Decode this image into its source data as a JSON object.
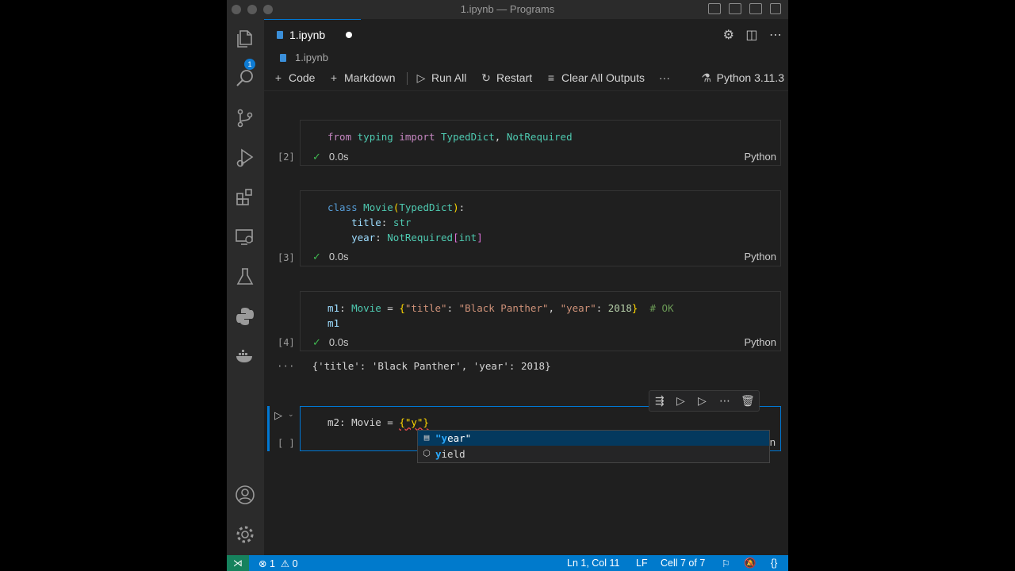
{
  "window": {
    "title": "1.ipynb — Programs"
  },
  "activity_bar": {
    "explorer_badge": "1",
    "items": [
      "files-icon",
      "search-icon",
      "source-control-icon",
      "run-debug-icon",
      "extensions-icon",
      "remote-explorer-icon",
      "testing-icon",
      "python-icon",
      "docker-icon"
    ]
  },
  "tab": {
    "label": "1.ipynb"
  },
  "breadcrumb": {
    "file": "1.ipynb"
  },
  "notebook_toolbar": {
    "code": "Code",
    "markdown": "Markdown",
    "run_all": "Run All",
    "restart": "Restart",
    "clear_outputs": "Clear All Outputs",
    "more": "···",
    "kernel": "Python 3.11.3"
  },
  "cells": [
    {
      "exec_count": "[2]",
      "code_lines": [
        "from typing import TypedDict, NotRequired"
      ],
      "time": "0.0s",
      "language": "Python"
    },
    {
      "exec_count": "[3]",
      "code_lines": [
        "class Movie(TypedDict):",
        "    title: str",
        "    year: NotRequired[int]"
      ],
      "time": "0.0s",
      "language": "Python"
    },
    {
      "exec_count": "[4]",
      "code_lines": [
        "m1: Movie = {\"title\": \"Black Panther\", \"year\": 2018}  # OK",
        "m1"
      ],
      "time": "0.0s",
      "language": "Python",
      "output": "{'title': 'Black Panther', 'year': 2018}",
      "output_prefix": "···"
    },
    {
      "exec_count": "[ ]",
      "code_prefix": "m2: Movie = ",
      "code_typed": "{\"y\"}",
      "language_partial": "n"
    }
  ],
  "suggestions": [
    {
      "label": "\"year\"",
      "match": "\"y",
      "rest": "ear\"",
      "icon": "text-icon",
      "selected": true
    },
    {
      "label": "yield",
      "match": "y",
      "rest": "ield",
      "icon": "keyword-icon",
      "selected": false
    }
  ],
  "statusbar": {
    "errors": "1",
    "warnings": "0",
    "position": "Ln 1, Col 11",
    "eol": "LF",
    "cell": "Cell 7 of 7",
    "braces": "{}"
  },
  "colors": {
    "accent": "#0078d4",
    "statusbar": "#007acc",
    "remote": "#16825d",
    "check": "#3fb950"
  }
}
